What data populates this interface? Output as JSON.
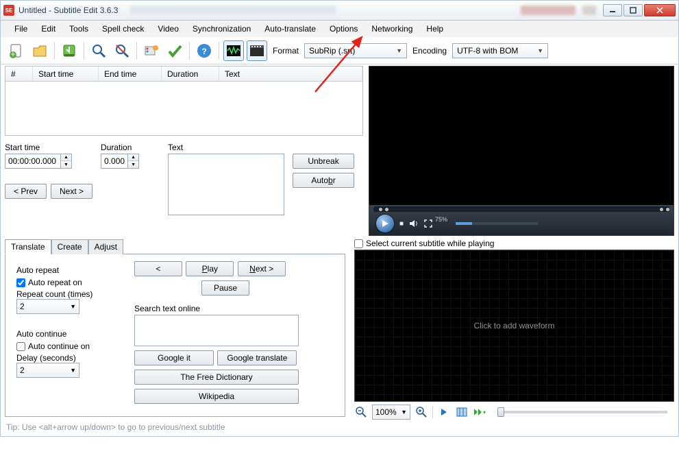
{
  "title": "Untitled - Subtitle Edit 3.6.3",
  "menu": [
    "File",
    "Edit",
    "Tools",
    "Spell check",
    "Video",
    "Synchronization",
    "Auto-translate",
    "Options",
    "Networking",
    "Help"
  ],
  "toolbar": {
    "format_label": "Format",
    "format_value": "SubRip (.srt)",
    "encoding_label": "Encoding",
    "encoding_value": "UTF-8 with BOM"
  },
  "table": {
    "headers": {
      "num": "#",
      "start": "Start time",
      "end": "End time",
      "dur": "Duration",
      "text": "Text"
    }
  },
  "edit": {
    "start_label": "Start time",
    "start_value": "00:00:00.000",
    "dur_label": "Duration",
    "dur_value": "0.000",
    "text_label": "Text",
    "unbreak": "Unbreak",
    "autobr_pre": "Auto ",
    "autobr_u": "b",
    "autobr_post": "r",
    "prev": "< Prev",
    "next": "Next >"
  },
  "tabs": {
    "translate": "Translate",
    "create": "Create",
    "adjust": "Adjust"
  },
  "translate": {
    "auto_repeat": "Auto repeat",
    "auto_repeat_on": "Auto repeat on",
    "repeat_count": "Repeat count (times)",
    "repeat_value": "2",
    "auto_continue": "Auto continue",
    "auto_continue_on": "Auto continue on",
    "delay": "Delay (seconds)",
    "delay_value": "2",
    "back": "<",
    "play_u": "P",
    "play_rest": "lay",
    "pause": "Pause",
    "next_u": "N",
    "next_rest": "ext >",
    "search": "Search text online",
    "google_it": "Google it",
    "google_tr": "Google translate",
    "dict": "The Free Dictionary",
    "wiki": "Wikipedia"
  },
  "video": {
    "pct": "75%"
  },
  "wave": {
    "select_cb": "Select current subtitle while playing",
    "placeholder": "Click to add waveform",
    "zoom": "100%"
  },
  "tip": "Tip: Use <alt+arrow up/down> to go to previous/next subtitle"
}
